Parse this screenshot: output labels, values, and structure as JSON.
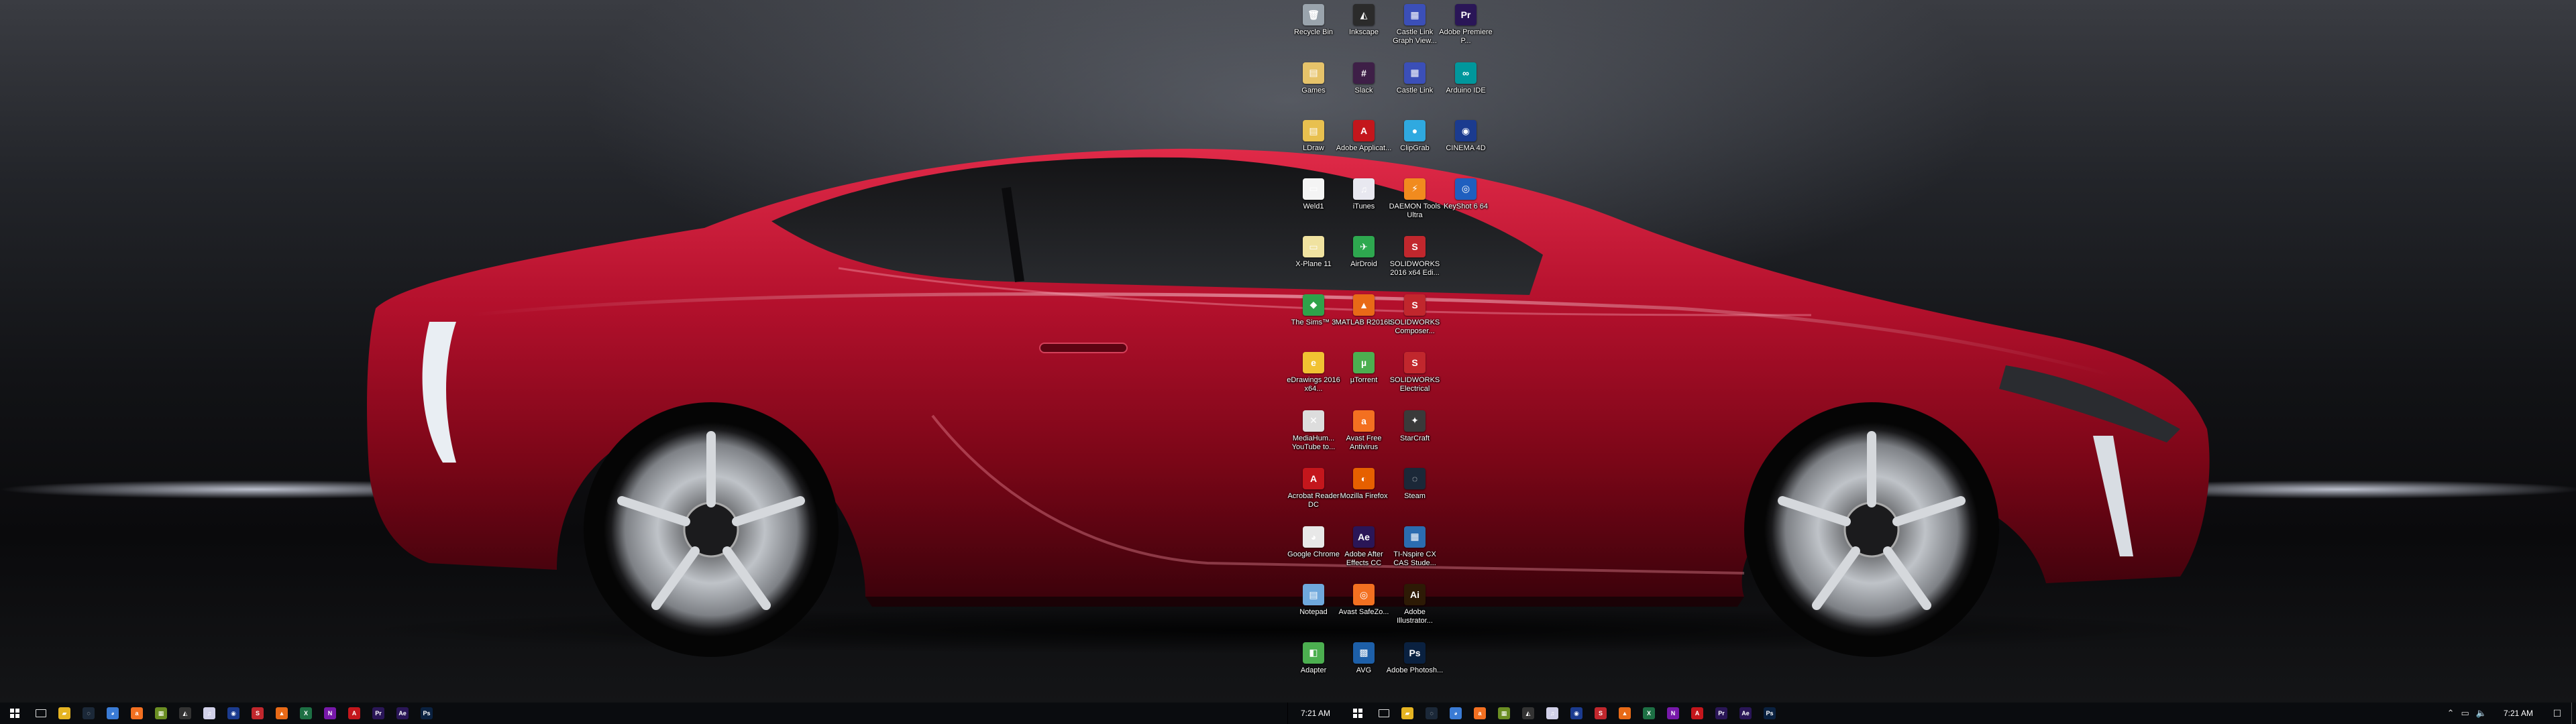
{
  "desktop": {
    "icons": [
      {
        "label": "Recycle Bin",
        "color": "#9aa4ad",
        "glyph": "🗑"
      },
      {
        "label": "Inkscape",
        "color": "#2b2b2b",
        "glyph": "◭"
      },
      {
        "label": "Castle Link Graph View...",
        "color": "#3b4fb8",
        "glyph": "▦"
      },
      {
        "label": "Adobe Premiere P...",
        "color": "#2a1657",
        "glyph": "Pr"
      },
      {
        "label": "Games",
        "color": "#e6c36a",
        "glyph": "▤"
      },
      {
        "label": "Slack",
        "color": "#3e1f47",
        "glyph": "#"
      },
      {
        "label": "Castle Link",
        "color": "#3b4fb8",
        "glyph": "▦"
      },
      {
        "label": "Arduino IDE",
        "color": "#00979c",
        "glyph": "∞"
      },
      {
        "label": "LDraw",
        "color": "#e8c04f",
        "glyph": "▤"
      },
      {
        "label": "Adobe Applicat...",
        "color": "#c4161c",
        "glyph": "A"
      },
      {
        "label": "ClipGrab",
        "color": "#2fa9e0",
        "glyph": "●"
      },
      {
        "label": "CINEMA 4D",
        "color": "#1b3b8f",
        "glyph": "◉"
      },
      {
        "label": "Weld1",
        "color": "#f4f4f4",
        "glyph": "▭"
      },
      {
        "label": "iTunes",
        "color": "#e8e8f0",
        "glyph": "♫"
      },
      {
        "label": "DAEMON Tools Ultra",
        "color": "#f18b1e",
        "glyph": "⚡"
      },
      {
        "label": "KeyShot 6 64",
        "color": "#1f5fbf",
        "glyph": "◎"
      },
      {
        "label": "X-Plane 11",
        "color": "#f0e2a0",
        "glyph": "▭"
      },
      {
        "label": "AirDroid",
        "color": "#2ea84f",
        "glyph": "✈"
      },
      {
        "label": "SOLIDWORKS 2016 x64 Edi...",
        "color": "#c1272d",
        "glyph": "S"
      },
      {
        "label": "",
        "color": "transparent",
        "glyph": ""
      },
      {
        "label": "The Sims™ 3",
        "color": "#2fa24a",
        "glyph": "◆"
      },
      {
        "label": "MATLAB R2016b",
        "color": "#e86a17",
        "glyph": "▲"
      },
      {
        "label": "SOLIDWORKS Composer...",
        "color": "#c1272d",
        "glyph": "S"
      },
      {
        "label": "",
        "color": "transparent",
        "glyph": ""
      },
      {
        "label": "eDrawings 2016 x64...",
        "color": "#f1c232",
        "glyph": "e"
      },
      {
        "label": "µTorrent",
        "color": "#4caf50",
        "glyph": "µ"
      },
      {
        "label": "SOLIDWORKS Electrical",
        "color": "#c1272d",
        "glyph": "S"
      },
      {
        "label": "",
        "color": "transparent",
        "glyph": ""
      },
      {
        "label": "MediaHum... YouTube to...",
        "color": "#ddd",
        "glyph": "✕"
      },
      {
        "label": "Avast Free Antivirus",
        "color": "#f37021",
        "glyph": "a"
      },
      {
        "label": "StarCraft",
        "color": "#3a3a3a",
        "glyph": "✦"
      },
      {
        "label": "",
        "color": "transparent",
        "glyph": ""
      },
      {
        "label": "Acrobat Reader DC",
        "color": "#c4161c",
        "glyph": "A"
      },
      {
        "label": "Mozilla Firefox",
        "color": "#e66000",
        "glyph": "◐"
      },
      {
        "label": "Steam",
        "color": "#1b2838",
        "glyph": "◌"
      },
      {
        "label": "",
        "color": "transparent",
        "glyph": ""
      },
      {
        "label": "Google Chrome",
        "color": "#e8e8e8",
        "glyph": "◕"
      },
      {
        "label": "Adobe After Effects CC",
        "color": "#2a1657",
        "glyph": "Ae"
      },
      {
        "label": "TI-Nspire CX CAS Stude...",
        "color": "#2b6cb0",
        "glyph": "▦"
      },
      {
        "label": "",
        "color": "transparent",
        "glyph": ""
      },
      {
        "label": "Notepad",
        "color": "#6fa8dc",
        "glyph": "▤"
      },
      {
        "label": "Avast SafeZo...",
        "color": "#f37021",
        "glyph": "◎"
      },
      {
        "label": "Adobe Illustrator...",
        "color": "#2d1a05",
        "glyph": "Ai"
      },
      {
        "label": "",
        "color": "transparent",
        "glyph": ""
      },
      {
        "label": "Adapter",
        "color": "#4caf50",
        "glyph": "◧"
      },
      {
        "label": "AVG",
        "color": "#1d5fa8",
        "glyph": "▩"
      },
      {
        "label": "Adobe Photosh...",
        "color": "#0a2140",
        "glyph": "Ps"
      }
    ]
  },
  "taskbar_left": {
    "pins": [
      {
        "name": "file-explorer",
        "glyph": "▰",
        "color": "#e6b422"
      },
      {
        "name": "steam",
        "glyph": "◌",
        "color": "#1b2838"
      },
      {
        "name": "chrome",
        "glyph": "◕",
        "color": "#3a7bd5"
      },
      {
        "name": "avast",
        "glyph": "a",
        "color": "#f37021"
      },
      {
        "name": "minecraft",
        "glyph": "▦",
        "color": "#6b8e23"
      },
      {
        "name": "inkscape",
        "glyph": "◭",
        "color": "#333"
      },
      {
        "name": "itunes",
        "glyph": "♫",
        "color": "#d0d0e8"
      },
      {
        "name": "cinema4d",
        "glyph": "◉",
        "color": "#1b3b8f"
      },
      {
        "name": "solidworks",
        "glyph": "S",
        "color": "#c1272d"
      },
      {
        "name": "matlab",
        "glyph": "▲",
        "color": "#e86a17"
      },
      {
        "name": "excel",
        "glyph": "X",
        "color": "#1d7044"
      },
      {
        "name": "onenote",
        "glyph": "N",
        "color": "#7719aa"
      },
      {
        "name": "adobe-reader",
        "glyph": "A",
        "color": "#c4161c"
      },
      {
        "name": "premiere",
        "glyph": "Pr",
        "color": "#2a1657"
      },
      {
        "name": "after-effects",
        "glyph": "Ae",
        "color": "#2a1657"
      },
      {
        "name": "photoshop",
        "glyph": "Ps",
        "color": "#0a2140"
      }
    ]
  },
  "taskbar_right": {
    "clock": "7:21 AM",
    "pins": [
      {
        "name": "file-explorer",
        "glyph": "▰",
        "color": "#e6b422"
      },
      {
        "name": "steam",
        "glyph": "◌",
        "color": "#1b2838"
      },
      {
        "name": "chrome",
        "glyph": "◕",
        "color": "#3a7bd5"
      },
      {
        "name": "avast",
        "glyph": "a",
        "color": "#f37021"
      },
      {
        "name": "minecraft",
        "glyph": "▦",
        "color": "#6b8e23"
      },
      {
        "name": "inkscape",
        "glyph": "◭",
        "color": "#333"
      },
      {
        "name": "itunes",
        "glyph": "♫",
        "color": "#d0d0e8"
      },
      {
        "name": "cinema4d",
        "glyph": "◉",
        "color": "#1b3b8f"
      },
      {
        "name": "solidworks",
        "glyph": "S",
        "color": "#c1272d"
      },
      {
        "name": "matlab",
        "glyph": "▲",
        "color": "#e86a17"
      },
      {
        "name": "excel",
        "glyph": "X",
        "color": "#1d7044"
      },
      {
        "name": "onenote",
        "glyph": "N",
        "color": "#7719aa"
      },
      {
        "name": "adobe-reader",
        "glyph": "A",
        "color": "#c4161c"
      },
      {
        "name": "premiere",
        "glyph": "Pr",
        "color": "#2a1657"
      },
      {
        "name": "after-effects",
        "glyph": "Ae",
        "color": "#2a1657"
      },
      {
        "name": "photoshop",
        "glyph": "Ps",
        "color": "#0a2140"
      }
    ],
    "tray": {
      "clock": "7:21 AM",
      "chevron_icon": "chevron-up-icon",
      "network_icon": "network-icon",
      "volume_icon": "volume-icon",
      "notification_icon": "notification-icon"
    }
  }
}
